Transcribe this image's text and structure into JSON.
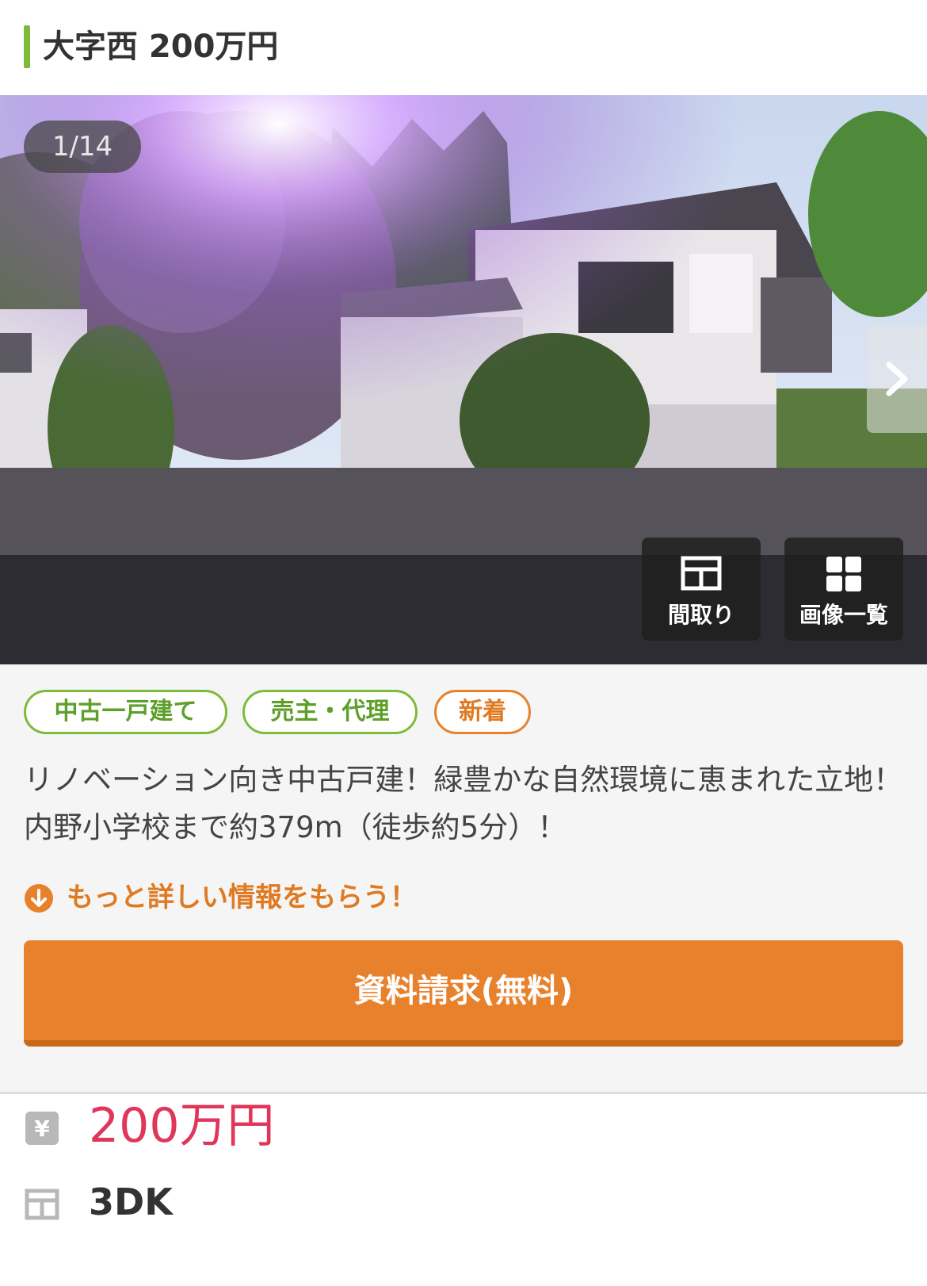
{
  "header": {
    "title": "大字西 200万円",
    "accent_color": "#7dbb3b"
  },
  "gallery": {
    "counter": "1/14",
    "next_icon": "chevron-right-icon",
    "actions": [
      {
        "label": "間取り",
        "icon": "floor-plan-icon"
      },
      {
        "label": "画像一覧",
        "icon": "grid-icon"
      }
    ]
  },
  "tags": [
    {
      "label": "中古一戸建て",
      "color": "#7dbb3b"
    },
    {
      "label": "売主・代理",
      "color": "#7dbb3b"
    },
    {
      "label": "新着",
      "color": "#e8812b"
    }
  ],
  "description": "リノベーション向き中古戸建！緑豊かな自然環境に恵まれた立地！内野小学校まで約379m（徒歩約5分）！",
  "more_info": {
    "text": "もっと詳しい情報をもらう！",
    "icon": "arrow-down-circle-icon"
  },
  "cta": {
    "label": "資料請求(無料)",
    "color": "#e8812b"
  },
  "specs": {
    "price": {
      "icon": "yen-icon",
      "value": "200万円",
      "color": "#e0365a"
    },
    "layout": {
      "icon": "floor-plan-icon",
      "value": "3DK"
    }
  }
}
